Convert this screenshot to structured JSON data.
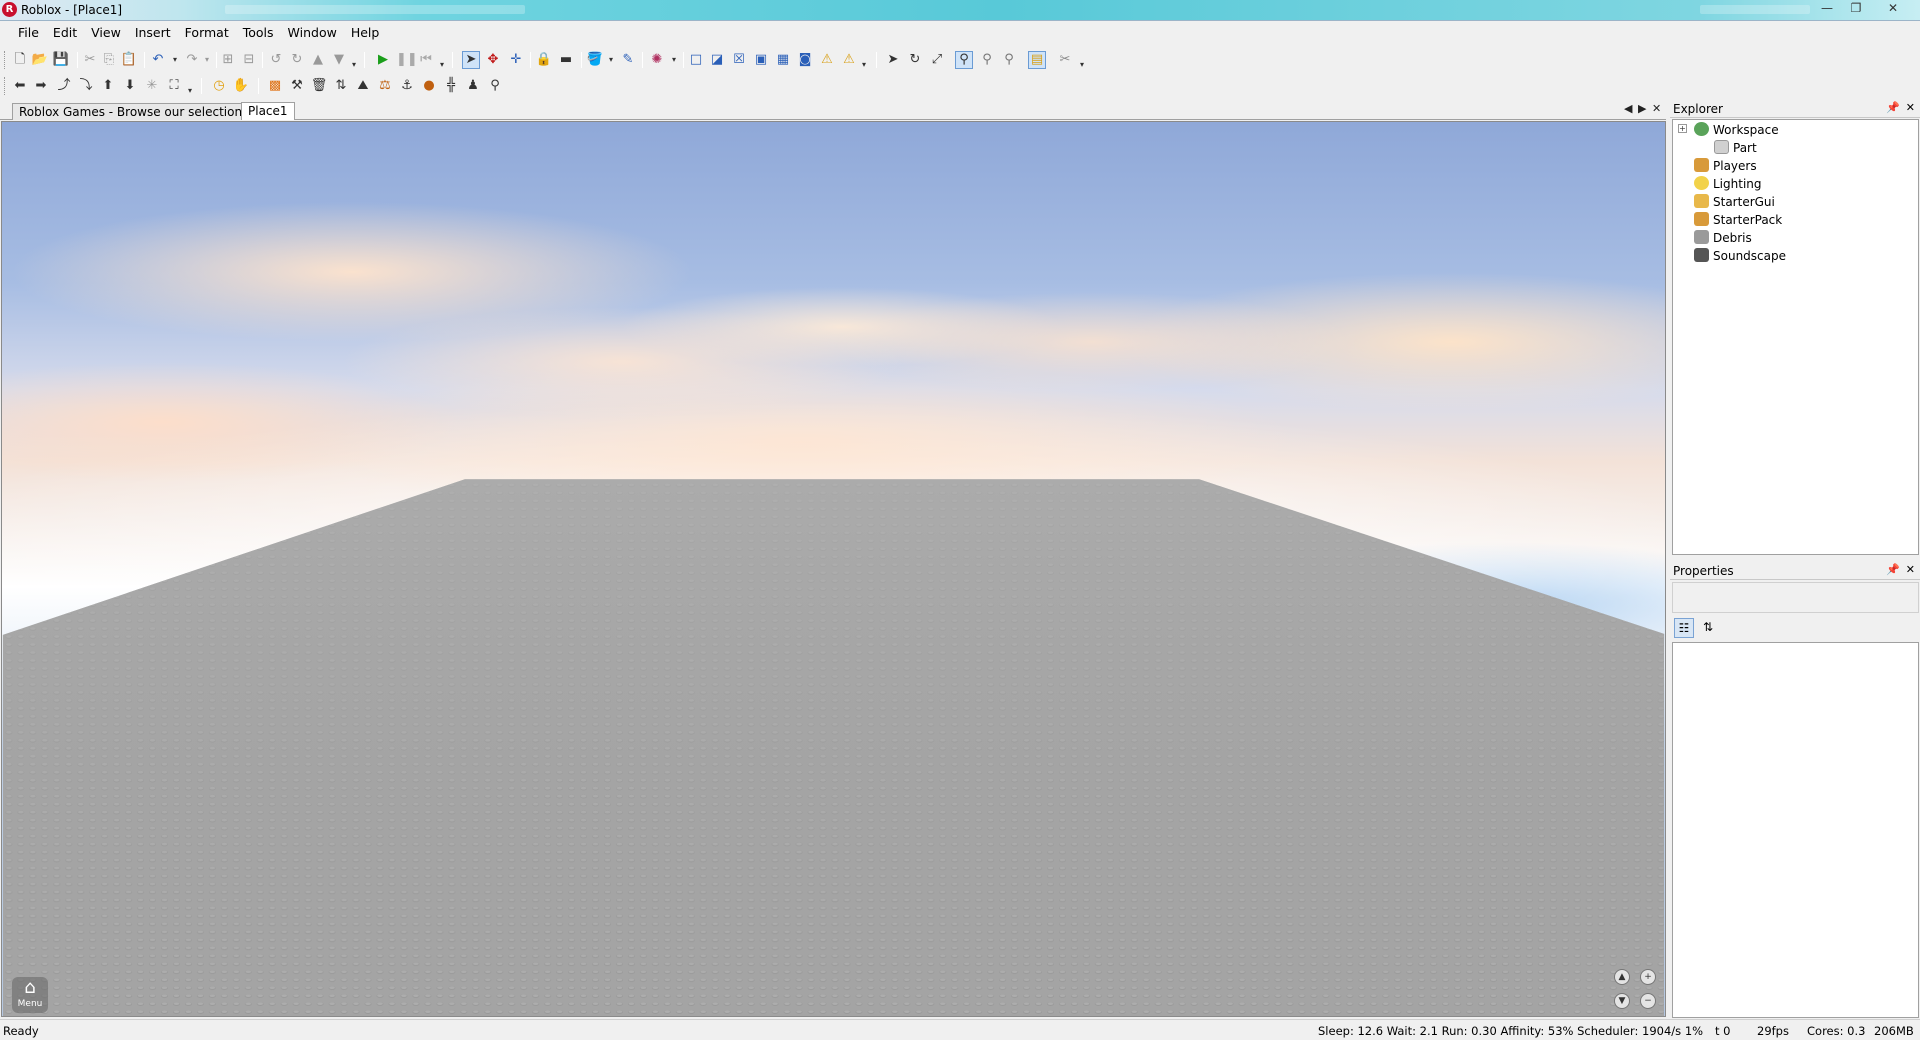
{
  "window": {
    "title": "Roblox - [Place1]",
    "minimize": "—",
    "maximize": "❐",
    "close": "✕"
  },
  "menu": [
    "File",
    "Edit",
    "View",
    "Insert",
    "Format",
    "Tools",
    "Window",
    "Help"
  ],
  "tabs": [
    {
      "label": "Roblox Games - Browse our selection ..."
    },
    {
      "label": "Place1"
    }
  ],
  "viewport": {
    "menu_label": "Menu"
  },
  "explorer": {
    "title": "Explorer",
    "items": [
      {
        "label": "Workspace",
        "icon": "globe-icon",
        "color": "#5aa35a"
      },
      {
        "label": "Part",
        "icon": "part-icon",
        "color": "#c8c8c8"
      },
      {
        "label": "Players",
        "icon": "players-icon",
        "color": "#d89a3a"
      },
      {
        "label": "Lighting",
        "icon": "lightbulb-icon",
        "color": "#f2d24a"
      },
      {
        "label": "StarterGui",
        "icon": "startergui-icon",
        "color": "#e8b84a"
      },
      {
        "label": "StarterPack",
        "icon": "starterpack-icon",
        "color": "#d89a3a"
      },
      {
        "label": "Debris",
        "icon": "debris-icon",
        "color": "#8a8a8a"
      },
      {
        "label": "Soundscape",
        "icon": "speaker-icon",
        "color": "#555555"
      }
    ]
  },
  "properties": {
    "title": "Properties"
  },
  "status": {
    "ready": "Ready",
    "perf": "Sleep: 12.6 Wait: 2.1 Run: 0.30 Affinity: 53% Scheduler: 1904/s 1%",
    "t": "t 0",
    "fps": "29fps",
    "cores": "Cores: 0.3",
    "mem": "206MB"
  },
  "colors": {
    "baseplate": "#a3a3a3",
    "accent_play": "#1a9e1a"
  }
}
